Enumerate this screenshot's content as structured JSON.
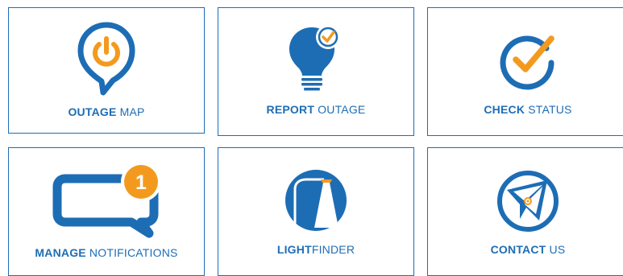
{
  "colors": {
    "blue": "#1d6db5",
    "orange": "#f39a1e",
    "white": "#ffffff"
  },
  "tiles": [
    {
      "bold": "OUTAGE",
      "rest": " MAP",
      "icon": "power-pin-icon"
    },
    {
      "bold": "REPORT",
      "rest": " OUTAGE",
      "icon": "lightbulb-check-icon"
    },
    {
      "bold": "CHECK",
      "rest": " STATUS",
      "icon": "checkmark-circle-icon"
    },
    {
      "bold": "MANAGE",
      "rest": " NOTIFICATIONS",
      "icon": "message-notification-icon",
      "badge": "1"
    },
    {
      "bold": "LIGHT",
      "rest": "FINDER",
      "icon": "streetlight-icon"
    },
    {
      "bold": "CONTACT",
      "rest": " US",
      "icon": "paper-plane-icon"
    }
  ]
}
